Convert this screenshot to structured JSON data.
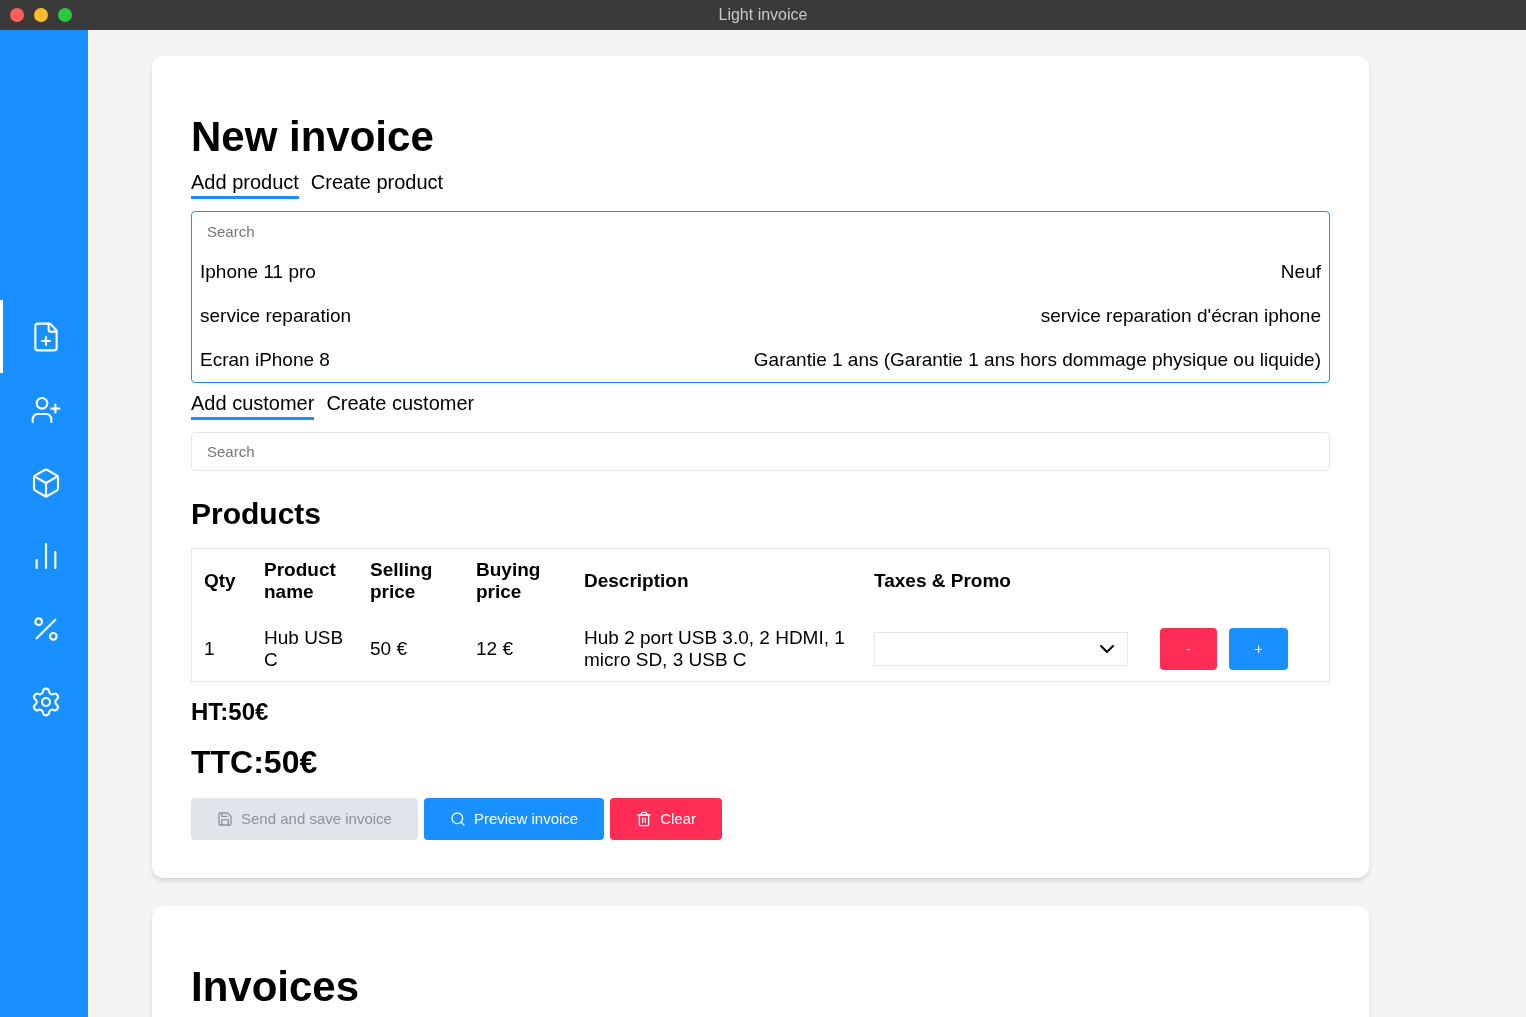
{
  "window": {
    "title": "Light invoice"
  },
  "sidebar": {
    "items": [
      {
        "kind": "file-plus",
        "selected": true
      },
      {
        "kind": "user-plus",
        "selected": false
      },
      {
        "kind": "box",
        "selected": false
      },
      {
        "kind": "chart",
        "selected": false
      },
      {
        "kind": "percent",
        "selected": false
      },
      {
        "kind": "settings",
        "selected": false
      }
    ]
  },
  "new_invoice": {
    "title": "New invoice",
    "product_tabs": [
      {
        "label": "Add product",
        "selected": true
      },
      {
        "label": "Create product",
        "selected": false
      }
    ],
    "product_search": {
      "placeholder": "Search",
      "results": [
        {
          "name": "Iphone 11 pro",
          "detail": "Neuf"
        },
        {
          "name": "service reparation",
          "detail": "service reparation d'écran iphone"
        },
        {
          "name": "Ecran iPhone 8",
          "detail": "Garantie 1 ans (Garantie 1 ans hors dommage physique ou liquide)"
        }
      ]
    },
    "customer_tabs": [
      {
        "label": "Add customer",
        "selected": true
      },
      {
        "label": "Create customer",
        "selected": false
      }
    ],
    "customer_search": {
      "placeholder": "Search"
    },
    "products_title": "Products",
    "table": {
      "columns": [
        "Qty",
        "Product name",
        "Selling price",
        "Buying price",
        "Description",
        "Taxes & Promo"
      ],
      "rows": [
        {
          "cells": [
            "1",
            "Hub USB C",
            "50 €",
            "12 €",
            "Hub 2 port USB 3.0, 2 HDMI, 1 micro SD, 3 USB C"
          ],
          "remove_label": "-",
          "add_label": "+"
        }
      ]
    },
    "ht": "HT:50€",
    "ttc": "TTC:50€",
    "buttons": [
      {
        "kind": "save",
        "label": "Send and save invoice",
        "disabled": true
      },
      {
        "kind": "preview",
        "label": "Preview invoice",
        "disabled": false
      },
      {
        "kind": "clear",
        "label": "Clear",
        "disabled": false
      }
    ]
  },
  "invoices": {
    "title": "Invoices"
  }
}
